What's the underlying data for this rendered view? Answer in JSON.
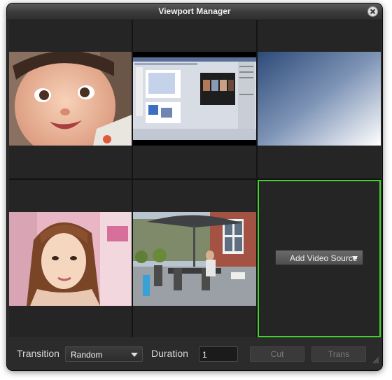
{
  "window": {
    "title": "Viewport Manager"
  },
  "viewports": [
    {
      "name": "baby",
      "has_video": true
    },
    {
      "name": "desktop-capture",
      "has_video": true
    },
    {
      "name": "gradient",
      "has_video": true
    },
    {
      "name": "girl-portrait",
      "has_video": true
    },
    {
      "name": "patio",
      "has_video": true
    },
    {
      "name": "empty",
      "has_video": false
    }
  ],
  "add_source": {
    "label": "Add Video Source"
  },
  "controls": {
    "transition_label": "Transition",
    "transition_value": "Random",
    "duration_label": "Duration",
    "duration_value": "1",
    "cut_label": "Cut",
    "trans_label": "Trans"
  },
  "colors": {
    "selected_border": "#3fd42a",
    "window_bg": "#2b2b2b"
  }
}
